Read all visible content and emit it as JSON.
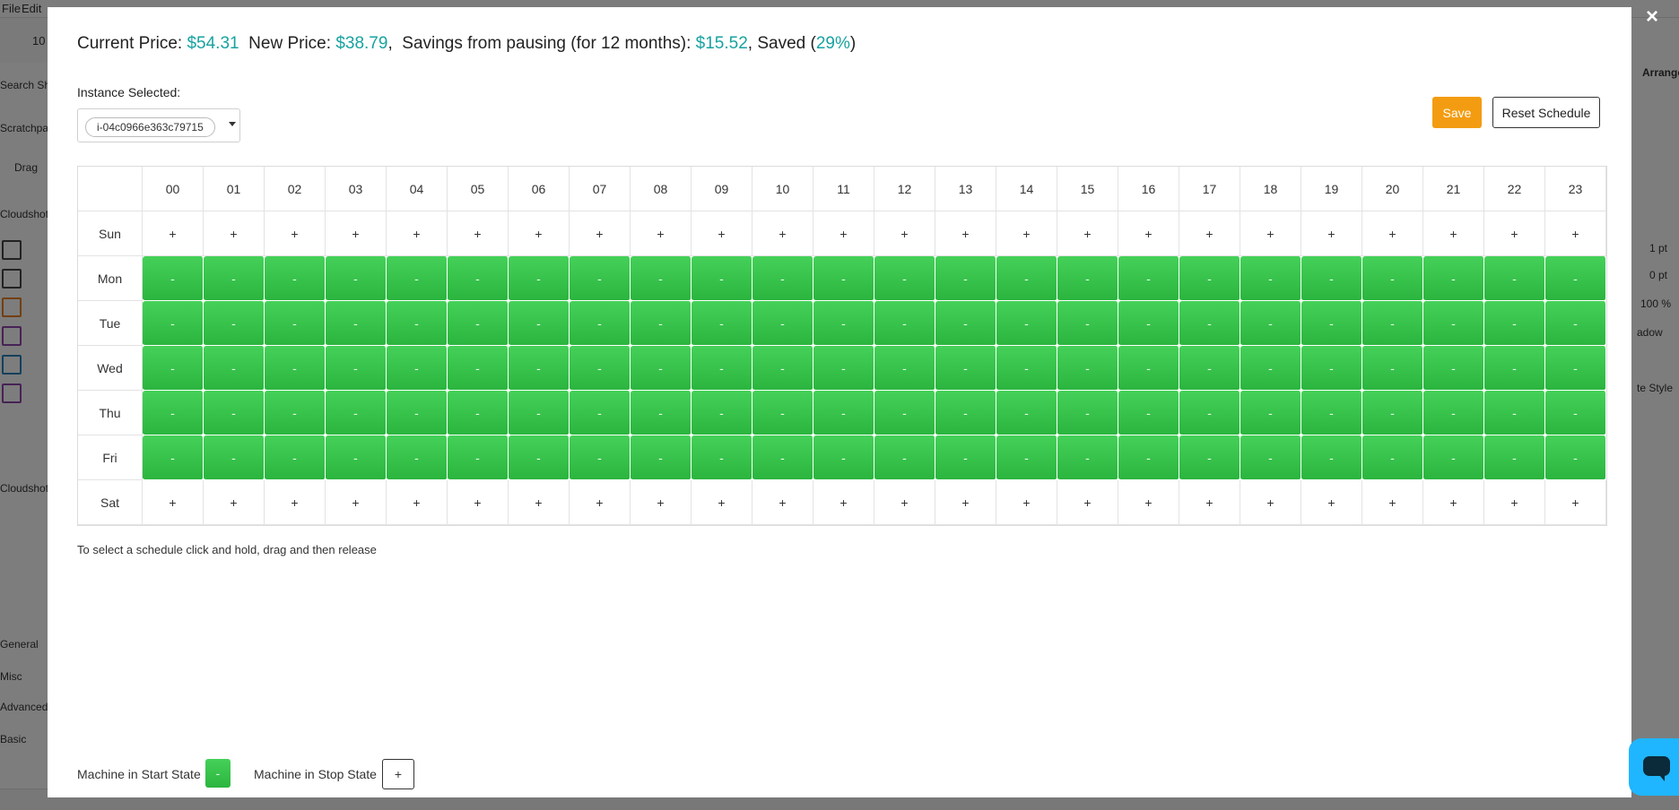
{
  "background": {
    "menu": [
      "File",
      "Edit"
    ],
    "toolbar_zoom": "10",
    "left_panel_labels": [
      "Search Shapes",
      "Scratchpad",
      "Drag",
      "Cloudshot",
      "Cloudshot",
      "General",
      "Misc",
      "Advanced",
      "Basic"
    ],
    "right_panel_labels": [
      "Arrange",
      "1 pt",
      "0 pt",
      "100 %",
      "adow",
      "te Style"
    ]
  },
  "pricing": {
    "current_label": "Current Price:",
    "current_value": "$54.31",
    "new_label": "New Price:",
    "new_value": "$38.79",
    "savings_label": "Savings from pausing (for 12 months):",
    "savings_value": "$15.52",
    "saved_label": "Saved",
    "saved_value": "29%"
  },
  "instance": {
    "label": "Instance Selected:",
    "selected": "i-04c0966e363c79715"
  },
  "actions": {
    "save_label": "Save",
    "reset_label": "Reset Schedule"
  },
  "schedule": {
    "hours": [
      "00",
      "01",
      "02",
      "03",
      "04",
      "05",
      "06",
      "07",
      "08",
      "09",
      "10",
      "11",
      "12",
      "13",
      "14",
      "15",
      "16",
      "17",
      "18",
      "19",
      "20",
      "21",
      "22",
      "23"
    ],
    "days": [
      {
        "name": "Sun",
        "state": "stop"
      },
      {
        "name": "Mon",
        "state": "start"
      },
      {
        "name": "Tue",
        "state": "start"
      },
      {
        "name": "Wed",
        "state": "start"
      },
      {
        "name": "Thu",
        "state": "start"
      },
      {
        "name": "Fri",
        "state": "start"
      },
      {
        "name": "Sat",
        "state": "stop"
      }
    ],
    "start_symbol": "-",
    "stop_symbol": "+"
  },
  "help_text": "To select a schedule click and hold, drag and then release",
  "legend": {
    "start_label": "Machine in Start State",
    "start_symbol": "-",
    "stop_label": "Machine in Stop State",
    "stop_symbol": "+"
  },
  "close_symbol": "×",
  "colors": {
    "start_green": "#2bb53f",
    "money_teal": "#17a2a0",
    "save_orange": "#f39c12",
    "chat_blue": "#1fb6ff"
  }
}
